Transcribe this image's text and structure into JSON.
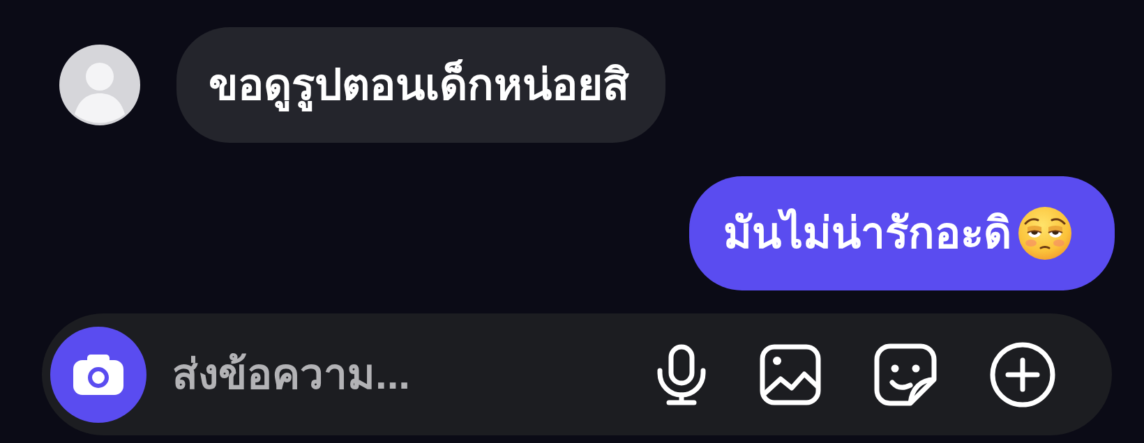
{
  "messages": [
    {
      "kind": "received",
      "text": "ขอดูรูปตอนเด็กหน่อยสิ",
      "emoji": false
    },
    {
      "kind": "sent",
      "text": "มันไม่น่ารักอะดิ",
      "emoji": true
    }
  ],
  "composer": {
    "placeholder": "ส่งข้อความ..."
  }
}
